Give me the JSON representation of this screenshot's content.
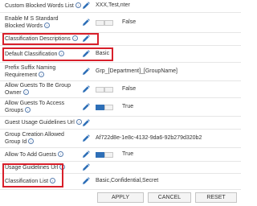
{
  "settings": [
    {
      "label_lines": [
        "Custom Blocked Words List"
      ],
      "info": true,
      "value": "XXX,Test,nter"
    },
    {
      "label_lines": [
        "Enable M S Standard",
        "Blocked Words"
      ],
      "info": true,
      "toggle": "False"
    },
    {
      "label_lines": [
        "Classification Descriptions"
      ],
      "info": true,
      "value": ""
    },
    {
      "label_lines": [
        "Default Classification"
      ],
      "info": true,
      "value": "Basic"
    },
    {
      "label_lines": [
        "Prefix Suffix Naming",
        "Requirement"
      ],
      "info": true,
      "value": "Grp_[Department]_[GroupName]"
    },
    {
      "label_lines": [
        "Allow Guests To Be Group",
        "Owner"
      ],
      "info": true,
      "toggle": "False"
    },
    {
      "label_lines": [
        "Allow Guests To Access",
        "Groups"
      ],
      "info": true,
      "toggle": "True"
    },
    {
      "label_lines": [
        "Guest Usage Guidelines Url"
      ],
      "info": true,
      "value": ""
    },
    {
      "label_lines": [
        "Group Creation Allowed",
        "Group Id"
      ],
      "info": true,
      "value": "Af722d8e-1e8c-4132-9da6-92b279d320b2"
    },
    {
      "label_lines": [
        "Allow To Add Guests"
      ],
      "info": true,
      "toggle": "True"
    },
    {
      "label_lines": [
        "Usage Guidelines Url"
      ],
      "info": true,
      "value": ""
    },
    {
      "label_lines": [
        "Classification List"
      ],
      "info": true,
      "value": "Basic,Confidential,Secret"
    }
  ],
  "highlighted_settings": [
    "Classification Descriptions",
    "Default Classification",
    "Classification List"
  ],
  "icons": {
    "edit": "pencil-icon",
    "info": "info-icon"
  },
  "info_glyph": "i",
  "colors": {
    "edit_icon": "#2e6fb7",
    "toggle_on": "#2e6fb7",
    "highlight": "#d81f2a"
  },
  "buttons": {
    "apply": "APPLY",
    "cancel": "CANCEL",
    "reset": "RESET"
  }
}
